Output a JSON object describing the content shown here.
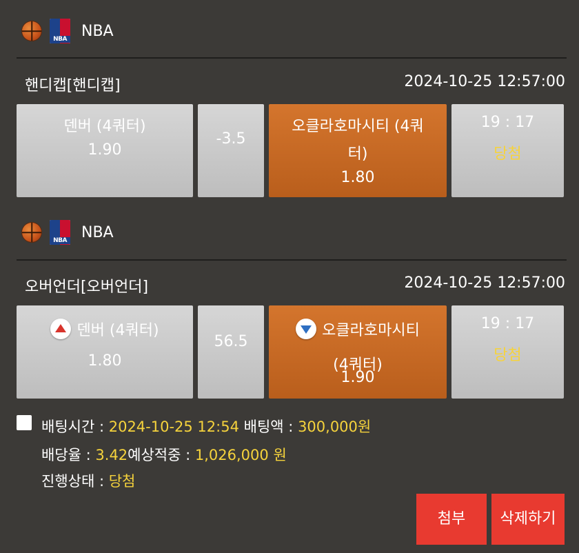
{
  "bets": [
    {
      "league": "NBA",
      "market_title": "핸디캡[핸디캡]",
      "datetime": "2024-10-25 12:57:00",
      "home": {
        "name": "덴버 (4쿼터)",
        "odds": "1.90"
      },
      "line": "-3.5",
      "away": {
        "name_line1": "오클라호마시티 (4쿼",
        "name_line2": "터)",
        "odds": "1.80"
      },
      "score": "19 : 17",
      "result": "당첨"
    },
    {
      "league": "NBA",
      "market_title": "오버언더[오버언더]",
      "datetime": "2024-10-25 12:57:00",
      "home": {
        "name": "덴버 (4쿼터)",
        "odds": "1.80"
      },
      "line": "56.5",
      "away": {
        "name_line1": "오클라호마시티",
        "name_line2": "(4쿼터)",
        "odds": "1.90"
      },
      "score": "19 : 17",
      "result": "당첨"
    }
  ],
  "summary": {
    "bet_time_label": "배팅시간 :",
    "bet_time": "2024-10-25 12:54",
    "bet_amount_label": "배팅액 :",
    "bet_amount": "300,000원",
    "odds_label": "배당율 :",
    "odds": "3.42",
    "expected_label": "예상적중 :",
    "expected": "1,026,000 원",
    "status_label": "진행상태 :",
    "status": "당첨"
  },
  "buttons": {
    "attach": "첨부",
    "delete": "삭제하기"
  },
  "colors": {
    "selected": "#c9661f",
    "neutral": "#c9c9c9",
    "highlight": "#f6d33c",
    "danger": "#e83a30"
  },
  "icons": [
    "basketball-icon",
    "nba-logo-icon",
    "over-arrow-icon",
    "under-arrow-icon"
  ]
}
